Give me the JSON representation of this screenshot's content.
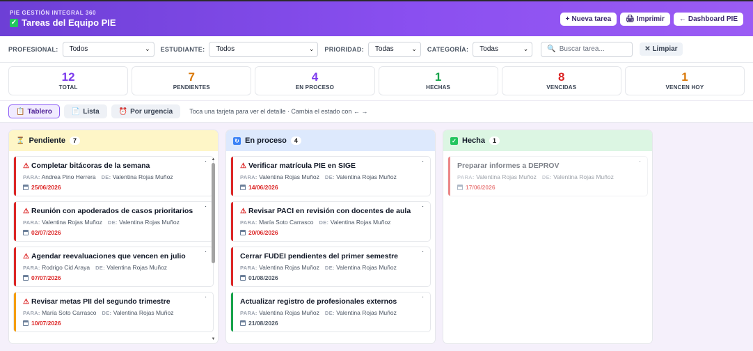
{
  "app": {
    "subtitle": "PIE GESTIÓN INTEGRAL 360",
    "title": "Tareas del Equipo PIE"
  },
  "header_actions": {
    "new_task": "Nueva tarea",
    "print": "Imprimir",
    "dashboard": "Dashboard PIE"
  },
  "filters": {
    "profesional_label": "PROFESIONAL:",
    "profesional_value": "Todos",
    "estudiante_label": "ESTUDIANTE:",
    "estudiante_value": "Todos",
    "prioridad_label": "PRIORIDAD:",
    "prioridad_value": "Todas",
    "categoria_label": "CATEGORÍA:",
    "categoria_value": "Todas",
    "search_placeholder": "Buscar tarea...",
    "clear_label": "Limpiar"
  },
  "stats": [
    {
      "value": "12",
      "label": "TOTAL",
      "color": "#7c3aed"
    },
    {
      "value": "7",
      "label": "PENDIENTES",
      "color": "#d97706"
    },
    {
      "value": "4",
      "label": "EN PROCESO",
      "color": "#7c3aed"
    },
    {
      "value": "1",
      "label": "HECHAS",
      "color": "#16a34a"
    },
    {
      "value": "8",
      "label": "VENCIDAS",
      "color": "#dc2626"
    },
    {
      "value": "1",
      "label": "VENCEN HOY",
      "color": "#d97706"
    }
  ],
  "views": {
    "board": "Tablero",
    "list": "Lista",
    "urgency": "Por urgencia",
    "hint": "Toca una tarjeta para ver el detalle · Cambia el estado con ← →"
  },
  "meta_labels": {
    "para": "PARA:",
    "de": "DE:"
  },
  "columns": [
    {
      "title": "Pendiente",
      "count": "7",
      "cards": [
        {
          "title": "Completar bitácoras de la semana",
          "para": "Andrea Pino Herrera",
          "de": "Valentina Rojas Muñoz",
          "date": "25/06/2026",
          "bar": "#dc2626",
          "warn": true,
          "overdue": true
        },
        {
          "title": "Reunión con apoderados de casos prioritarios",
          "para": "Valentina Rojas Muñoz",
          "de": "Valentina Rojas Muñoz",
          "date": "02/07/2026",
          "bar": "#dc2626",
          "warn": true,
          "overdue": true
        },
        {
          "title": "Agendar reevaluaciones que vencen en julio",
          "para": "Rodrigo Cid Araya",
          "de": "Valentina Rojas Muñoz",
          "date": "07/07/2026",
          "bar": "#dc2626",
          "warn": true,
          "overdue": true
        },
        {
          "title": "Revisar metas PII del segundo trimestre",
          "para": "María Soto Carrasco",
          "de": "Valentina Rojas Muñoz",
          "date": "10/07/2026",
          "bar": "#f59e0b",
          "warn": true,
          "overdue": true
        }
      ]
    },
    {
      "title": "En proceso",
      "count": "4",
      "cards": [
        {
          "title": "Verificar matrícula PIE en SIGE",
          "para": "Valentina Rojas Muñoz",
          "de": "Valentina Rojas Muñoz",
          "date": "14/06/2026",
          "bar": "#dc2626",
          "warn": true,
          "overdue": true
        },
        {
          "title": "Revisar PACI en revisión con docentes de aula",
          "para": "María Soto Carrasco",
          "de": "Valentina Rojas Muñoz",
          "date": "20/06/2026",
          "bar": "#dc2626",
          "warn": true,
          "overdue": true
        },
        {
          "title": "Cerrar FUDEI pendientes del primer semestre",
          "para": "Valentina Rojas Muñoz",
          "de": "Valentina Rojas Muñoz",
          "date": "01/08/2026",
          "bar": "#dc2626",
          "warn": false,
          "overdue": false
        },
        {
          "title": "Actualizar registro de profesionales externos",
          "para": "Valentina Rojas Muñoz",
          "de": "Valentina Rojas Muñoz",
          "date": "21/08/2026",
          "bar": "#16a34a",
          "warn": false,
          "overdue": false
        }
      ]
    },
    {
      "title": "Hecha",
      "count": "1",
      "cards": [
        {
          "title": "Preparar informes a DEPROV",
          "para": "Valentina Rojas Muñoz",
          "de": "Valentina Rojas Muñoz",
          "date": "17/06/2026",
          "bar": "#dc2626",
          "warn": false,
          "overdue": true,
          "done": true
        }
      ]
    }
  ]
}
